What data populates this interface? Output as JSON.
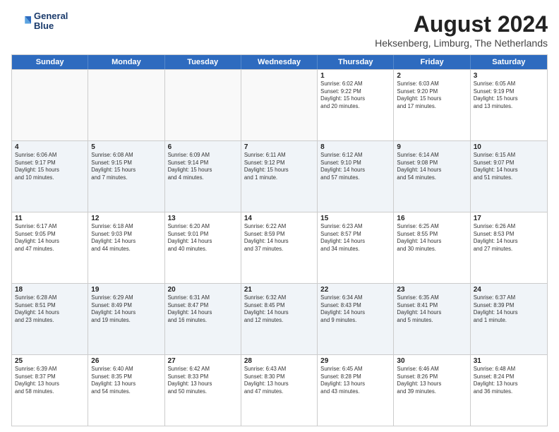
{
  "header": {
    "logo_line1": "General",
    "logo_line2": "Blue",
    "main_title": "August 2024",
    "subtitle": "Heksenberg, Limburg, The Netherlands"
  },
  "weekdays": [
    "Sunday",
    "Monday",
    "Tuesday",
    "Wednesday",
    "Thursday",
    "Friday",
    "Saturday"
  ],
  "rows": [
    [
      {
        "day": "",
        "text": "",
        "empty": true
      },
      {
        "day": "",
        "text": "",
        "empty": true
      },
      {
        "day": "",
        "text": "",
        "empty": true
      },
      {
        "day": "",
        "text": "",
        "empty": true
      },
      {
        "day": "1",
        "text": "Sunrise: 6:02 AM\nSunset: 9:22 PM\nDaylight: 15 hours\nand 20 minutes.",
        "empty": false
      },
      {
        "day": "2",
        "text": "Sunrise: 6:03 AM\nSunset: 9:20 PM\nDaylight: 15 hours\nand 17 minutes.",
        "empty": false
      },
      {
        "day": "3",
        "text": "Sunrise: 6:05 AM\nSunset: 9:19 PM\nDaylight: 15 hours\nand 13 minutes.",
        "empty": false
      }
    ],
    [
      {
        "day": "4",
        "text": "Sunrise: 6:06 AM\nSunset: 9:17 PM\nDaylight: 15 hours\nand 10 minutes.",
        "empty": false
      },
      {
        "day": "5",
        "text": "Sunrise: 6:08 AM\nSunset: 9:15 PM\nDaylight: 15 hours\nand 7 minutes.",
        "empty": false
      },
      {
        "day": "6",
        "text": "Sunrise: 6:09 AM\nSunset: 9:14 PM\nDaylight: 15 hours\nand 4 minutes.",
        "empty": false
      },
      {
        "day": "7",
        "text": "Sunrise: 6:11 AM\nSunset: 9:12 PM\nDaylight: 15 hours\nand 1 minute.",
        "empty": false
      },
      {
        "day": "8",
        "text": "Sunrise: 6:12 AM\nSunset: 9:10 PM\nDaylight: 14 hours\nand 57 minutes.",
        "empty": false
      },
      {
        "day": "9",
        "text": "Sunrise: 6:14 AM\nSunset: 9:08 PM\nDaylight: 14 hours\nand 54 minutes.",
        "empty": false
      },
      {
        "day": "10",
        "text": "Sunrise: 6:15 AM\nSunset: 9:07 PM\nDaylight: 14 hours\nand 51 minutes.",
        "empty": false
      }
    ],
    [
      {
        "day": "11",
        "text": "Sunrise: 6:17 AM\nSunset: 9:05 PM\nDaylight: 14 hours\nand 47 minutes.",
        "empty": false
      },
      {
        "day": "12",
        "text": "Sunrise: 6:18 AM\nSunset: 9:03 PM\nDaylight: 14 hours\nand 44 minutes.",
        "empty": false
      },
      {
        "day": "13",
        "text": "Sunrise: 6:20 AM\nSunset: 9:01 PM\nDaylight: 14 hours\nand 40 minutes.",
        "empty": false
      },
      {
        "day": "14",
        "text": "Sunrise: 6:22 AM\nSunset: 8:59 PM\nDaylight: 14 hours\nand 37 minutes.",
        "empty": false
      },
      {
        "day": "15",
        "text": "Sunrise: 6:23 AM\nSunset: 8:57 PM\nDaylight: 14 hours\nand 34 minutes.",
        "empty": false
      },
      {
        "day": "16",
        "text": "Sunrise: 6:25 AM\nSunset: 8:55 PM\nDaylight: 14 hours\nand 30 minutes.",
        "empty": false
      },
      {
        "day": "17",
        "text": "Sunrise: 6:26 AM\nSunset: 8:53 PM\nDaylight: 14 hours\nand 27 minutes.",
        "empty": false
      }
    ],
    [
      {
        "day": "18",
        "text": "Sunrise: 6:28 AM\nSunset: 8:51 PM\nDaylight: 14 hours\nand 23 minutes.",
        "empty": false
      },
      {
        "day": "19",
        "text": "Sunrise: 6:29 AM\nSunset: 8:49 PM\nDaylight: 14 hours\nand 19 minutes.",
        "empty": false
      },
      {
        "day": "20",
        "text": "Sunrise: 6:31 AM\nSunset: 8:47 PM\nDaylight: 14 hours\nand 16 minutes.",
        "empty": false
      },
      {
        "day": "21",
        "text": "Sunrise: 6:32 AM\nSunset: 8:45 PM\nDaylight: 14 hours\nand 12 minutes.",
        "empty": false
      },
      {
        "day": "22",
        "text": "Sunrise: 6:34 AM\nSunset: 8:43 PM\nDaylight: 14 hours\nand 9 minutes.",
        "empty": false
      },
      {
        "day": "23",
        "text": "Sunrise: 6:35 AM\nSunset: 8:41 PM\nDaylight: 14 hours\nand 5 minutes.",
        "empty": false
      },
      {
        "day": "24",
        "text": "Sunrise: 6:37 AM\nSunset: 8:39 PM\nDaylight: 14 hours\nand 1 minute.",
        "empty": false
      }
    ],
    [
      {
        "day": "25",
        "text": "Sunrise: 6:39 AM\nSunset: 8:37 PM\nDaylight: 13 hours\nand 58 minutes.",
        "empty": false
      },
      {
        "day": "26",
        "text": "Sunrise: 6:40 AM\nSunset: 8:35 PM\nDaylight: 13 hours\nand 54 minutes.",
        "empty": false
      },
      {
        "day": "27",
        "text": "Sunrise: 6:42 AM\nSunset: 8:33 PM\nDaylight: 13 hours\nand 50 minutes.",
        "empty": false
      },
      {
        "day": "28",
        "text": "Sunrise: 6:43 AM\nSunset: 8:30 PM\nDaylight: 13 hours\nand 47 minutes.",
        "empty": false
      },
      {
        "day": "29",
        "text": "Sunrise: 6:45 AM\nSunset: 8:28 PM\nDaylight: 13 hours\nand 43 minutes.",
        "empty": false
      },
      {
        "day": "30",
        "text": "Sunrise: 6:46 AM\nSunset: 8:26 PM\nDaylight: 13 hours\nand 39 minutes.",
        "empty": false
      },
      {
        "day": "31",
        "text": "Sunrise: 6:48 AM\nSunset: 8:24 PM\nDaylight: 13 hours\nand 36 minutes.",
        "empty": false
      }
    ]
  ]
}
